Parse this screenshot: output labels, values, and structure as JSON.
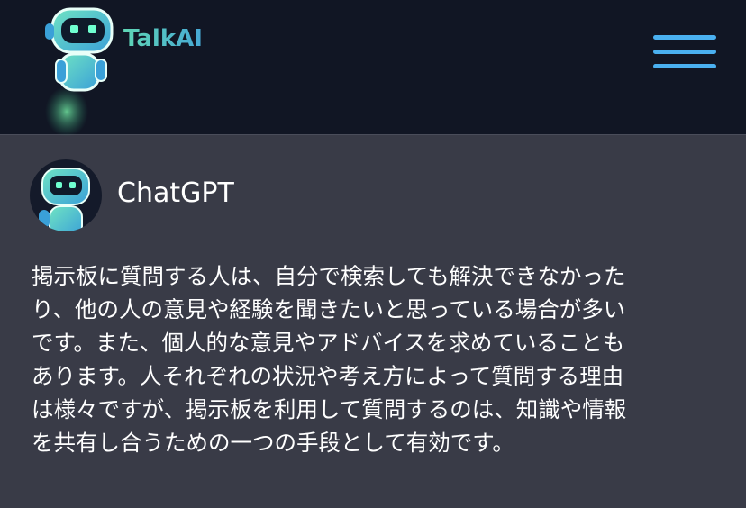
{
  "header": {
    "brand": "TalkAI",
    "logo_icon": "robot-icon",
    "menu_icon": "hamburger-menu-icon"
  },
  "post": {
    "avatar_icon": "robot-avatar-icon",
    "author": "ChatGPT",
    "lines": [
      "掲示板に質問する人は、自分で検索しても解決できなかった",
      "り、他の人の意見や経験を聞きたいと思っている場合が多い",
      "です。また、個人的な意見やアドバイスを求めていることも",
      "あります。人それぞれの状況や考え方によって質問する理由",
      "は様々ですが、掲示板を利用して質問するのは、知識や情報",
      "を共有し合うための一つの手段として有効です。"
    ]
  },
  "colors": {
    "header_bg": "#111624",
    "page_bg": "#393b47",
    "brand_gradient_start": "#5fd6b5",
    "brand_gradient_end": "#47a9d6",
    "menu_accent": "#4ab0f0",
    "text": "#ffffff"
  }
}
